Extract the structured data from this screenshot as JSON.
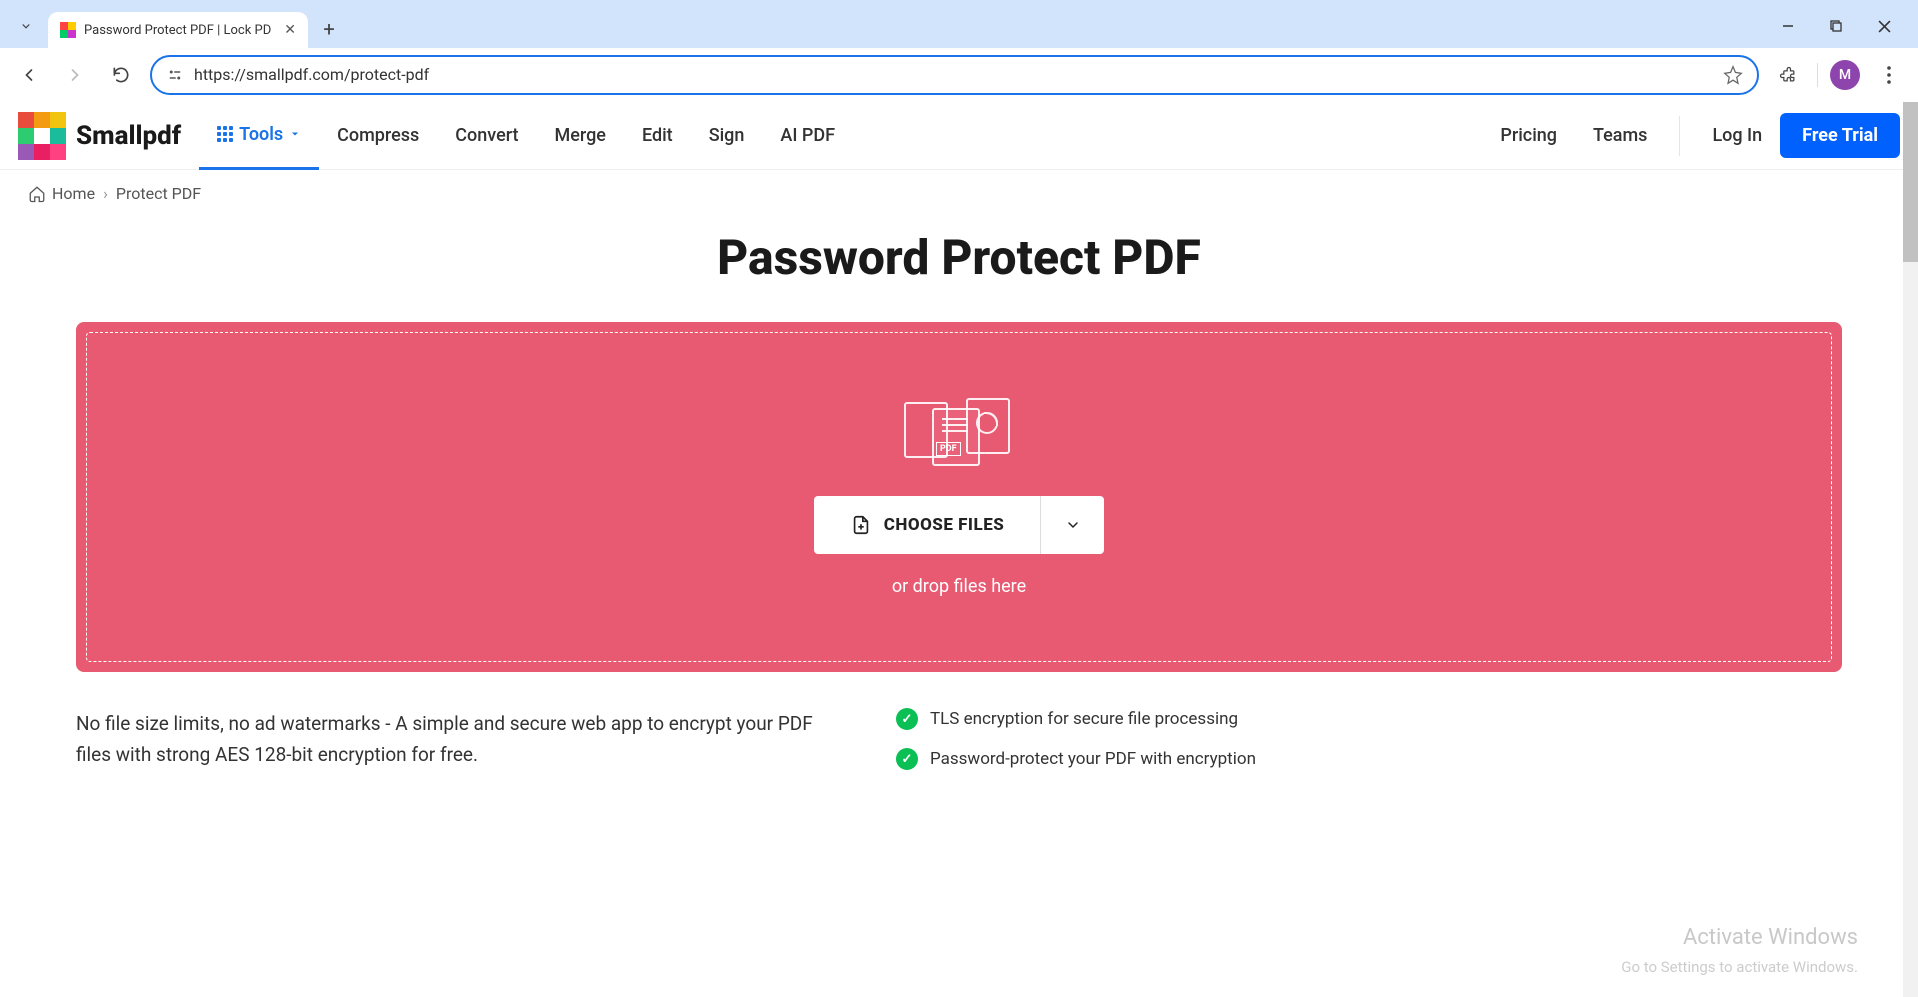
{
  "browser": {
    "tab_title": "Password Protect PDF | Lock PD",
    "url": "https://smallpdf.com/protect-pdf",
    "avatar_letter": "M"
  },
  "nav": {
    "logo_text": "Smallpdf",
    "items": {
      "tools": "Tools",
      "compress": "Compress",
      "convert": "Convert",
      "merge": "Merge",
      "edit": "Edit",
      "sign": "Sign",
      "aipdf": "AI PDF"
    },
    "right": {
      "pricing": "Pricing",
      "teams": "Teams",
      "login": "Log In",
      "free_trial": "Free Trial"
    }
  },
  "breadcrumb": {
    "home": "Home",
    "current": "Protect PDF"
  },
  "page": {
    "title": "Password Protect PDF",
    "choose_label": "CHOOSE FILES",
    "drop_hint": "or drop files here",
    "description": "No file size limits, no ad watermarks - A simple and secure web app to encrypt your PDF files with strong AES 128-bit encryption for free.",
    "features": [
      "TLS encryption for secure file processing",
      "Password-protect your PDF with encryption"
    ]
  },
  "watermark": {
    "line1": "Activate Windows",
    "line2": "Go to Settings to activate Windows."
  }
}
